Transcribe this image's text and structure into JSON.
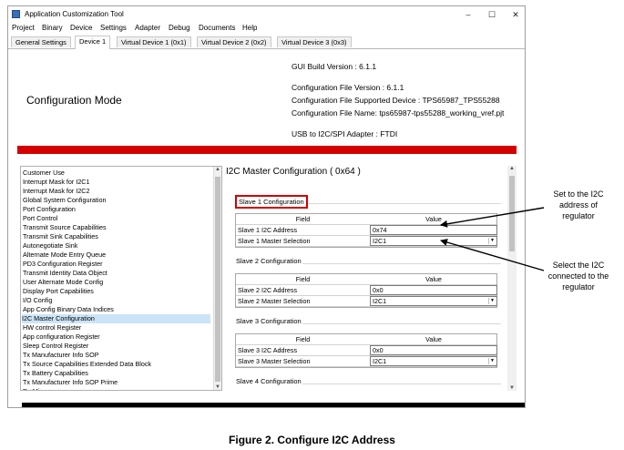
{
  "window": {
    "title": "Application Customization Tool",
    "controls": {
      "minimize": "–",
      "maximize": "☐",
      "close": "✕"
    }
  },
  "menu": [
    "Project",
    "Binary",
    "Device",
    "Settings",
    "Adapter",
    "Debug",
    "Documents",
    "Help"
  ],
  "tabs": [
    "General Settings",
    "Device 1",
    "Virtual Device 1 (0x1)",
    "Virtual Device 2 (0x2)",
    "Virtual Device 3 (0x3)"
  ],
  "active_tab": "Device 1",
  "info": {
    "gui_build_version": "GUI Build Version : 6.1.1",
    "config_file_version": "Configuration File Version : 6.1.1",
    "config_supported_device": "Configuration File Supported Device : TPS65987_TPS55288",
    "config_file_name": "Configuration File Name: tps65987-tps55288_working_vref.pjt",
    "adapter": "USB to I2C/SPI Adapter : FTDI"
  },
  "mode_label": "Configuration Mode",
  "status_bar_color": "#d40000",
  "register_list": [
    "Customer Use",
    "Interrupt Mask for I2C1",
    "Interrupt Mask for I2C2",
    "Global System Configuration",
    "Port Configuration",
    "Port Control",
    "Transmit Source Capabilities",
    "Transmit Sink Capabilities",
    "Autonegotiate Sink",
    "Alternate Mode Entry Queue",
    "PD3 Configuration Register",
    "Transmit Identity Data Object",
    "User Alternate Mode Config",
    "Display Port Capabilities",
    "I/O Config",
    "App Config Binary Data Indices",
    "I2C Master Configuration",
    "HW control Register",
    "App configuration Register",
    "Sleep Control Register",
    "Tx Manufacturer Info SOP",
    "Tx Source Capabilities Extended Data Block",
    "Tx Battery Capabilities",
    "Tx Manufacturer Info SOP Prime",
    "Rx Misc..."
  ],
  "selected_register": "I2C Master Configuration",
  "panel": {
    "title": "I2C Master Configuration  ( 0x64 )",
    "table_headers": {
      "field": "Field",
      "value": "Value"
    },
    "groups": [
      {
        "label": "Slave 1 Configuration",
        "rows": [
          {
            "field": "Slave 1 I2C Address",
            "value": "0x74",
            "dropdown": false
          },
          {
            "field": "Slave 1 Master Selection",
            "value": "I2C1",
            "dropdown": true
          }
        ]
      },
      {
        "label": "Slave 2 Configuration",
        "rows": [
          {
            "field": "Slave 2 I2C Address",
            "value": "0x0",
            "dropdown": false
          },
          {
            "field": "Slave 2 Master Selection",
            "value": "I2C1",
            "dropdown": true
          }
        ]
      },
      {
        "label": "Slave 3 Configuration",
        "rows": [
          {
            "field": "Slave 3 I2C Address",
            "value": "0x0",
            "dropdown": false
          },
          {
            "field": "Slave 3 Master Selection",
            "value": "I2C1",
            "dropdown": true
          }
        ]
      },
      {
        "label": "Slave 4 Configuration",
        "rows": []
      }
    ]
  },
  "annotations": {
    "a1": [
      "Set to the I2C",
      "address of",
      "regulator"
    ],
    "a2": [
      "Select the I2C",
      "connected to the",
      "regulator"
    ]
  },
  "caption": "Figure 2. Configure I2C Address"
}
